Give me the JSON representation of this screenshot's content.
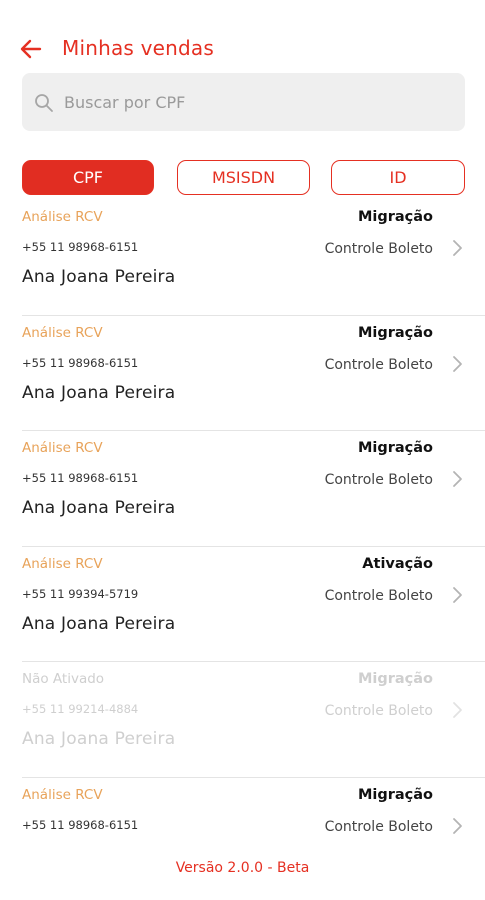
{
  "header": {
    "title": "Minhas vendas",
    "back_icon": "arrow-left-icon"
  },
  "search": {
    "placeholder": "Buscar por CPF",
    "value": "",
    "icon": "search-icon"
  },
  "filters": [
    {
      "label": "CPF",
      "active": true
    },
    {
      "label": "MSISDN",
      "active": false
    },
    {
      "label": "ID",
      "active": false
    }
  ],
  "sales": [
    {
      "status": "Análise RCV",
      "phone": "+55 11 98968-6151",
      "name": "Ana Joana Pereira",
      "type": "Migração",
      "plan": "Controle Boleto",
      "disabled": false
    },
    {
      "status": "Análise RCV",
      "phone": "+55 11 98968-6151",
      "name": "Ana Joana Pereira",
      "type": "Migração",
      "plan": "Controle Boleto",
      "disabled": false
    },
    {
      "status": "Análise RCV",
      "phone": "+55 11 98968-6151",
      "name": "Ana Joana Pereira",
      "type": "Migração",
      "plan": "Controle Boleto",
      "disabled": false
    },
    {
      "status": "Análise RCV",
      "phone": "+55 11 99394-5719",
      "name": "Ana Joana Pereira",
      "type": "Ativação",
      "plan": "Controle Boleto",
      "disabled": false
    },
    {
      "status": "Não Ativado",
      "phone": "+55 11 99214-4884",
      "name": "Ana Joana Pereira",
      "type": "Migração",
      "plan": "Controle Boleto",
      "disabled": true
    },
    {
      "status": "Análise RCV",
      "phone": "+55 11 98968-6151",
      "name": "",
      "type": "Migração",
      "plan": "Controle Boleto",
      "disabled": false
    }
  ],
  "footer": {
    "version": "Versão 2.0.0 - Beta"
  },
  "colors": {
    "accent": "#e53022",
    "status_orange": "#e8a35a",
    "disabled_gray": "#cfcfcf"
  }
}
